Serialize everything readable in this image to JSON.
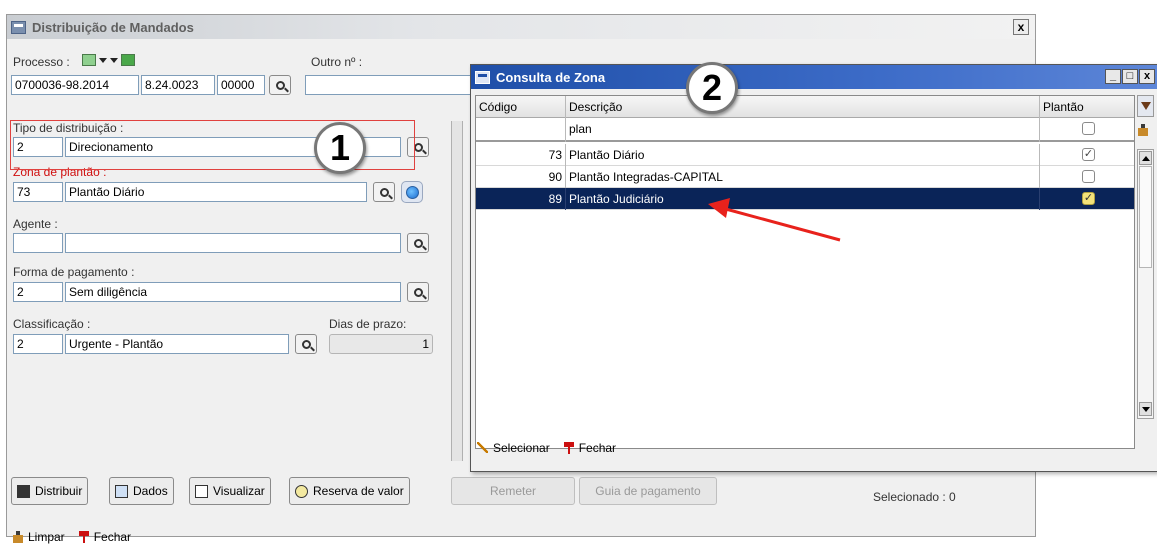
{
  "main_window": {
    "title": "Distribuição de Mandados",
    "close_glyph": "x"
  },
  "processo": {
    "label": "Processo :",
    "part1": "0700036-98.2014",
    "part2": "8.24.0023",
    "part3": "00000"
  },
  "outro_numero": {
    "label": "Outro nº :",
    "value": ""
  },
  "tipo_distribuicao": {
    "label": "Tipo de distribuição :",
    "code": "2",
    "value": "Direcionamento"
  },
  "zona_plantao": {
    "label": "Zona de plantão :",
    "code": "73",
    "value": "Plantão Diário"
  },
  "agente": {
    "label": "Agente :",
    "code": "",
    "value": ""
  },
  "forma_pagamento": {
    "label": "Forma de pagamento :",
    "code": "2",
    "value": "Sem diligência"
  },
  "classificacao": {
    "label": "Classificação :",
    "code": "2",
    "value": "Urgente - Plantão"
  },
  "dias_prazo": {
    "label": "Dias de prazo:",
    "value": "1"
  },
  "bottom_buttons": {
    "distribuir": "Distribuir",
    "dados": "Dados",
    "visualizar": "Visualizar",
    "reserva": "Reserva de valor",
    "remeter": "Remeter",
    "guia": "Guia de pagamento"
  },
  "selecionado": "Selecionado : 0",
  "footer": {
    "limpar": "Limpar",
    "fechar": "Fechar"
  },
  "annotations": {
    "badge1": "1",
    "badge2": "2"
  },
  "dialog": {
    "title": "Consulta de Zona",
    "window_buttons": [
      "_",
      "□",
      "x"
    ],
    "columns": [
      "Código",
      "Descrição",
      "Plantão"
    ],
    "filter": {
      "codigo": "",
      "descricao": "plan"
    },
    "rows": [
      {
        "codigo": "73",
        "descricao": "Plantão Diário",
        "plantao": true,
        "selected": false
      },
      {
        "codigo": "90",
        "descricao": "Plantão Integradas-CAPITAL",
        "plantao": false,
        "selected": false
      },
      {
        "codigo": "89",
        "descricao": "Plantão Judiciário",
        "plantao": true,
        "selected": true
      }
    ],
    "footer": {
      "selecionar": "Selecionar",
      "fechar": "Fechar"
    }
  },
  "colors": {
    "accent_red": "#d01010",
    "dialog_title": "#1f4fa8",
    "selected_row": "#0a2458"
  }
}
